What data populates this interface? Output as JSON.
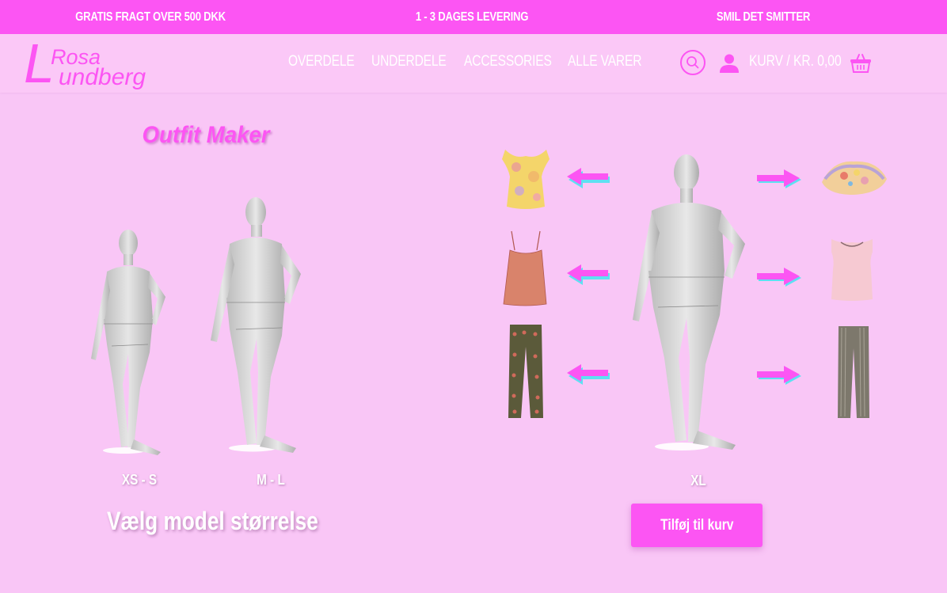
{
  "topbar": {
    "msg1": "GRATIS FRAGT OVER 500 DKK",
    "msg2": "1 - 3 DAGES LEVERING",
    "msg3": "SMIL DET SMITTER"
  },
  "logo": {
    "initial": "L",
    "first": "Rosa",
    "last": "undberg"
  },
  "nav": {
    "items": [
      "OVERDELE",
      "UNDERDELE",
      "ACCESSORIES",
      "ALLE VARER"
    ],
    "cart_label": "KURV / KR. 0,00"
  },
  "icons": {
    "search": "search-icon",
    "user": "user-icon",
    "cart": "basket-icon"
  },
  "main": {
    "title": "Outfit Maker",
    "sizes": [
      "XS - S",
      "M - L",
      "XL"
    ],
    "choose_label": "Vælg model størrelse",
    "add_button": "Tilføj til kurv"
  },
  "colors": {
    "accent": "#fc55f3",
    "background": "#f9c6f6",
    "arrow_cyan": "#5ee0f2"
  }
}
